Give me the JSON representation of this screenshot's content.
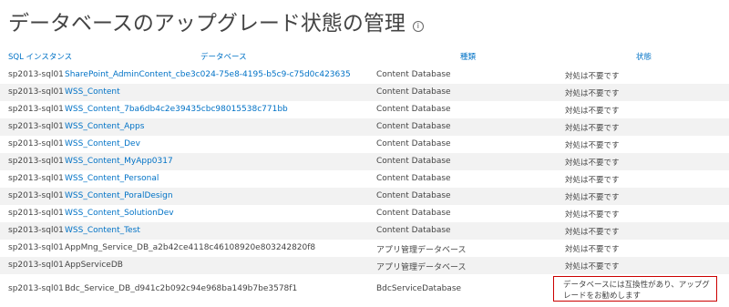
{
  "page": {
    "title": "データベースのアップグレード状態の管理",
    "info_icon": "i"
  },
  "columns": {
    "server": "SQL インスタンス",
    "database": "データベース",
    "type": "種類",
    "status": "状態"
  },
  "rows": [
    {
      "server": "sp2013-sql01",
      "database": "SharePoint_AdminContent_cbe3c024-75e8-4195-b5c9-c75d0c423635",
      "type": "Content Database",
      "status": "対処は不要です"
    },
    {
      "server": "sp2013-sql01",
      "database": "WSS_Content",
      "type": "Content Database",
      "status": "対処は不要です"
    },
    {
      "server": "sp2013-sql01",
      "database": "WSS_Content_7ba6db4c2e39435cbc98015538c771bb",
      "type": "Content Database",
      "status": "対処は不要です"
    },
    {
      "server": "sp2013-sql01",
      "database": "WSS_Content_Apps",
      "type": "Content Database",
      "status": "対処は不要です"
    },
    {
      "server": "sp2013-sql01",
      "database": "WSS_Content_Dev",
      "type": "Content Database",
      "status": "対処は不要です"
    },
    {
      "server": "sp2013-sql01",
      "database": "WSS_Content_MyApp0317",
      "type": "Content Database",
      "status": "対処は不要です"
    },
    {
      "server": "sp2013-sql01",
      "database": "WSS_Content_Personal",
      "type": "Content Database",
      "status": "対処は不要です"
    },
    {
      "server": "sp2013-sql01",
      "database": "WSS_Content_PoralDesign",
      "type": "Content Database",
      "status": "対処は不要です"
    },
    {
      "server": "sp2013-sql01",
      "database": "WSS_Content_SolutionDev",
      "type": "Content Database",
      "status": "対処は不要です"
    },
    {
      "server": "sp2013-sql01",
      "database": "WSS_Content_Test",
      "type": "Content Database",
      "status": "対処は不要です"
    },
    {
      "server": "sp2013-sql01",
      "database": "AppMng_Service_DB_a2b42ce4118c46108920e803242820f8",
      "type": "アプリ管理データベース",
      "status": "対処は不要です"
    },
    {
      "server": "sp2013-sql01",
      "database": "AppServiceDB",
      "type": "アプリ管理データベース",
      "status": "対処は不要です"
    },
    {
      "server": "sp2013-sql01",
      "database": "Bdc_Service_DB_d941c2b092c94e968ba149b7be3578f1",
      "type": "BdcServiceDatabase",
      "status": "データベースには互換性があり、アップグレードをお勧めします"
    }
  ]
}
